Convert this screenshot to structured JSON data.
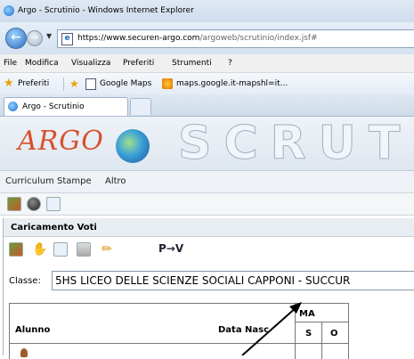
{
  "browser": {
    "window_title": "Argo - Scrutinio - Windows Internet Explorer",
    "url_domain": "https://www.securen-argo.com",
    "url_path": "/argoweb/scrutinio/index.jsf#",
    "menu": [
      "File",
      "Modifica",
      "Visualizza",
      "Preferiti",
      "Strumenti",
      "?"
    ],
    "favorites": {
      "label": "Preferiti",
      "items": [
        "Google Maps",
        "maps.google.it-mapshl=it..."
      ]
    },
    "tab_title": "Argo - Scrutinio"
  },
  "banner": {
    "logo_text": "ARGO",
    "title_text": "SCRUTI"
  },
  "app_menu": [
    "Curriculum",
    "Stampe",
    "Altro"
  ],
  "panel": {
    "title": "Caricamento Voti",
    "tool_text": "P→V",
    "classe_label": "Classe:",
    "classe_value": "5HS LICEO DELLE SCIENZE SOCIALI CAPPONI - SUCCUR"
  },
  "grid": {
    "col_alunno": "Alunno",
    "col_data": "Data Nasc",
    "col_group": "MA",
    "col_s": "S",
    "col_o": "O"
  },
  "colors": {
    "logo": "#d8502e",
    "ie_blue": "#1a6fc9"
  }
}
